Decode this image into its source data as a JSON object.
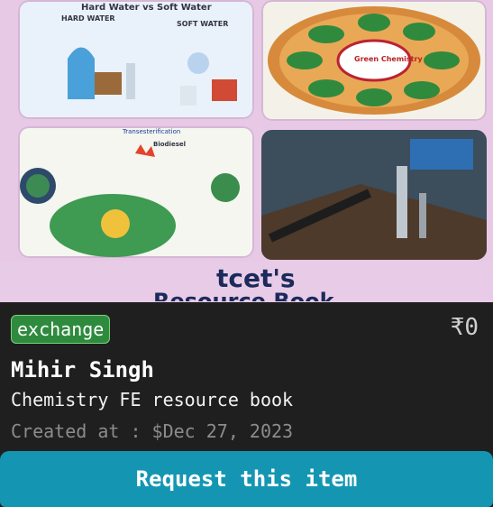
{
  "photo": {
    "panels": [
      {
        "title": "Hard Water vs Soft Water",
        "left_label": "HARD WATER",
        "right_label": "SOFT WATER"
      },
      {
        "title": "Green Chemistry"
      },
      {
        "title": "Transesterification",
        "note": "Biodiesel"
      },
      {
        "title": "Pipeline landscape"
      }
    ],
    "brand": "tcet's",
    "brand_sub": "Resource Book"
  },
  "item": {
    "tag": "exchange",
    "price": "₹0",
    "owner": "Mihir Singh",
    "title": "Chemistry FE resource book",
    "created": "Created at : $Dec 27, 2023"
  },
  "actions": {
    "request_label": "Request this item"
  },
  "colors": {
    "tag_bg": "#2e8b3e",
    "button_bg": "#1496b3",
    "card_bg": "#1f1f1f"
  }
}
